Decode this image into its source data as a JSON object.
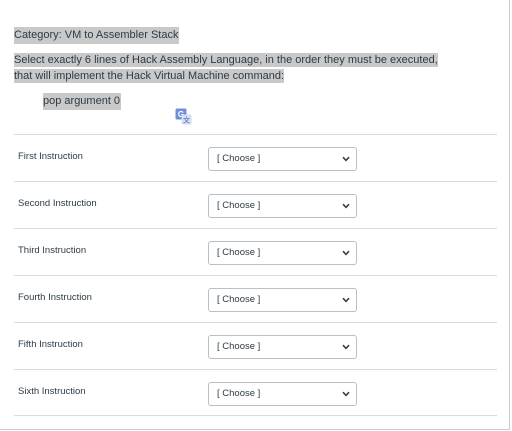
{
  "question": {
    "category": "Category: VM to Assembler Stack",
    "prompt": "Select exactly 6 lines of Hack Assembly Language, in the order they must be executed, that will implement the Hack Virtual Machine command:",
    "command": "pop argument 0"
  },
  "icons": {
    "translate": "translate-icon",
    "dropdown": "chevron-down-icon"
  },
  "colors": {
    "highlight": "#c9c9c9",
    "translate_icon": "#6f8fd8"
  },
  "rows": [
    {
      "label": "First Instruction",
      "selected": "[ Choose ]"
    },
    {
      "label": "Second Instruction",
      "selected": "[ Choose ]"
    },
    {
      "label": "Third Instruction",
      "selected": "[ Choose ]"
    },
    {
      "label": "Fourth Instruction",
      "selected": "[ Choose ]"
    },
    {
      "label": "Fifth Instruction",
      "selected": "[ Choose ]"
    },
    {
      "label": "Sixth Instruction",
      "selected": "[ Choose ]"
    }
  ]
}
